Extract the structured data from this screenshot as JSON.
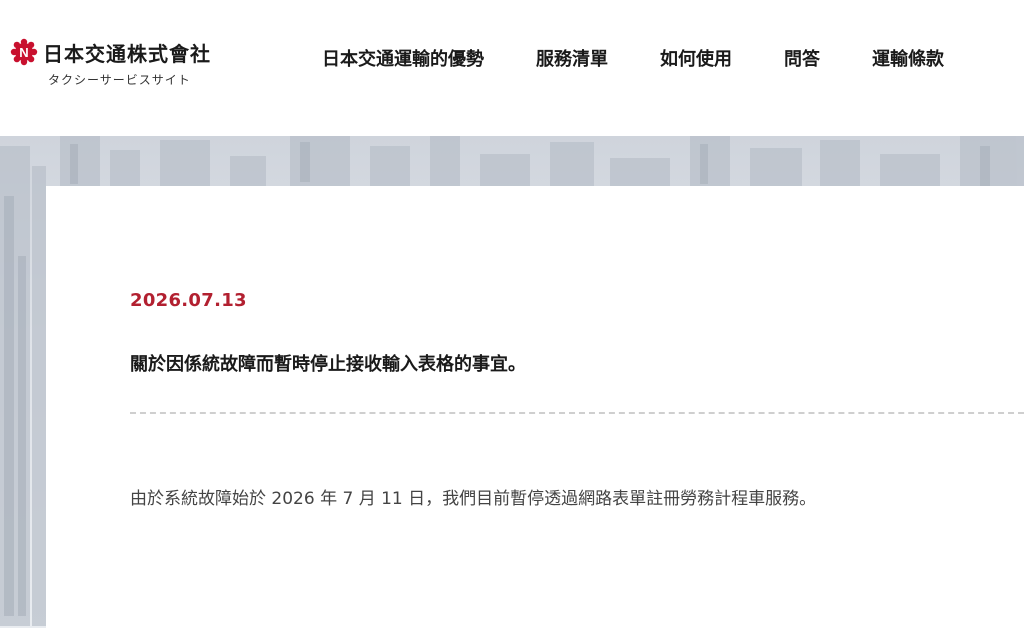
{
  "header": {
    "logo_text": "日本交通株式會社",
    "logo_subtitle": "タクシーサービスサイト",
    "logo_mark_letter": "N",
    "logo_color": "#c8102e"
  },
  "nav": {
    "items": [
      {
        "label": "日本交通運輸的優勢"
      },
      {
        "label": "服務清單"
      },
      {
        "label": "如何使用"
      },
      {
        "label": "問答"
      },
      {
        "label": "運輸條款"
      }
    ]
  },
  "notice": {
    "date": "2026.07.13",
    "title": "關於因係統故障而暫時停止接收輸入表格的事宜。",
    "body": "由於系統故障始於 2026 年 7 月 11 日，我們目前暫停透過網路表單註冊勞務計程車服務。"
  },
  "colors": {
    "accent_red": "#b22030",
    "divider": "#cfcfcf"
  }
}
